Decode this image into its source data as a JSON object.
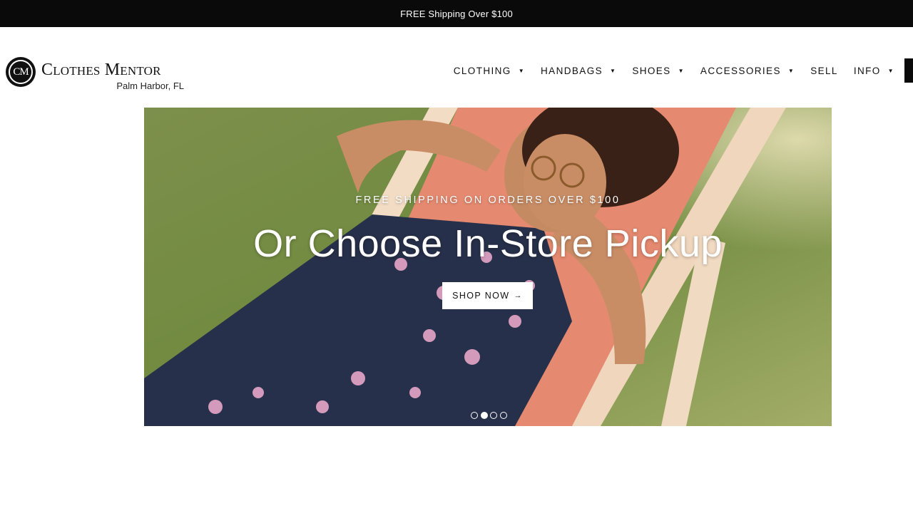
{
  "announcement": {
    "text": "FREE Shipping Over $100"
  },
  "logo": {
    "monogram": "CM",
    "name": "Clothes Mentor",
    "location": "Palm Harbor, FL"
  },
  "nav": {
    "items": [
      {
        "label": "CLOTHING",
        "caret": "▼"
      },
      {
        "label": "HANDBAGS",
        "caret": "▼"
      },
      {
        "label": "SHOES",
        "caret": "▼"
      },
      {
        "label": "ACCESSORIES",
        "caret": "▼"
      },
      {
        "label": "SELL",
        "caret": ""
      },
      {
        "label": "INFO",
        "caret": "▼"
      }
    ]
  },
  "hero": {
    "eyebrow": "FREE SHIPPING ON ORDERS OVER $100",
    "title": "Or Choose In-Store Pickup",
    "button_label": "SHOP NOW",
    "button_arrow": "→",
    "slides_total": 4,
    "active_slide": 2
  },
  "colors": {
    "bar": "#0a0a0a",
    "accent": "#ffffff",
    "text": "#111111"
  }
}
